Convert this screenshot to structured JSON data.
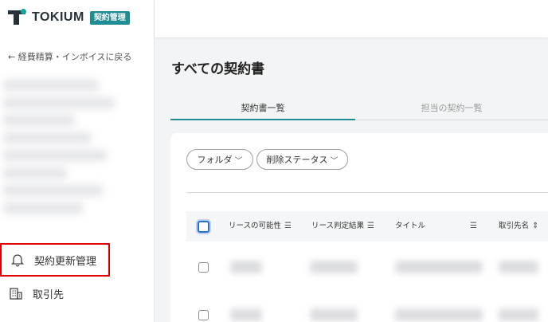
{
  "brand": {
    "name": "TOKIUM",
    "badge": "契約管理"
  },
  "sidebar": {
    "back_link": "← 経費精算・インボイスに戻る",
    "items": [
      {
        "label": "契約更新管理",
        "icon": "bell-icon"
      },
      {
        "label": "取引先",
        "icon": "building-icon"
      }
    ]
  },
  "main": {
    "title": "すべての契約書",
    "tabs": [
      {
        "label": "契約書一覧",
        "active": true
      },
      {
        "label": "担当の契約一覧",
        "active": false
      }
    ],
    "filters": [
      {
        "label": "フォルダ"
      },
      {
        "label": "削除ステータス"
      }
    ],
    "table": {
      "columns": [
        {
          "label": "リースの可能性"
        },
        {
          "label": "リース判定結果"
        },
        {
          "label": "タイトル"
        },
        {
          "label": "取引先名"
        }
      ]
    }
  },
  "colors": {
    "accent": "#1e8d94",
    "highlight": "#e00000"
  }
}
